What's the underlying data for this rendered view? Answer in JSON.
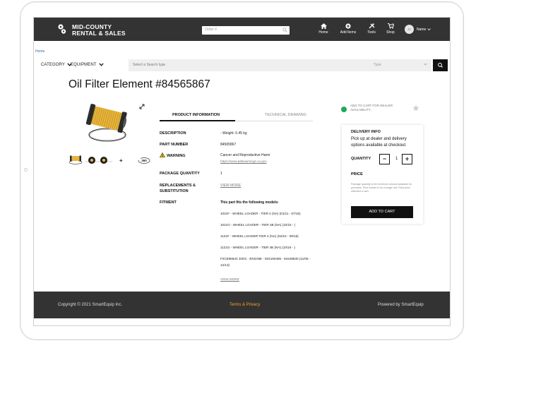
{
  "brand": {
    "line1": "MID-COUNTY",
    "line2": "RENTAL & SALES"
  },
  "search": {
    "placeholder": "Order #"
  },
  "nav": [
    {
      "label": "Home",
      "icon": "home-icon"
    },
    {
      "label": "Add Items",
      "icon": "add-circle-icon"
    },
    {
      "label": "Tools",
      "icon": "tools-icon"
    },
    {
      "label": "Shop",
      "icon": "cart-icon"
    }
  ],
  "user": {
    "initials": "JS",
    "name": "Name"
  },
  "breadcrumb": "Home",
  "filters": {
    "category": "CATEGORY",
    "equipment": "EQUIPMENT",
    "type_placeholder": "Select a Search type",
    "type_value": "Type"
  },
  "product": {
    "title": "Oil Filter Element #84565867",
    "tabs": {
      "info": "PRODUCT INFORMATION",
      "drawing": "TECHNICAL DRAWING"
    },
    "plus": "+",
    "spin_label": "360",
    "details": {
      "description_label": "DESCRIPTION",
      "description_value": "- Weight: 0.45 kg",
      "part_label": "PART NUMBER",
      "part_value": "84565867",
      "warning_label": "WARNING",
      "warning_value": "Cancer and Reproductive Harm",
      "warning_link": "https://www.p65warnings.ca.gov",
      "package_label": "PACKAGE QUANTITY",
      "package_value": "1",
      "replacements_label_1": "REPLACEMENTS &",
      "replacements_label_2": "SUBSTITUTION",
      "replacements_link": "VIEW MORE",
      "fitment_label": "FITMENT",
      "fitment_head": "This part fits the following models:",
      "fitment_models": [
        "1021F - WHEEL LOADER - TIER 4 (NA) (01/11 - 07/16)",
        "1021G - WHEEL LOADER - TIER 4B (NA) (10/16 - )",
        "1121F - WHEEL LOADER TIER 4 (NA) (04/10 - 09/16)",
        "1121G - WHEEL LOADER - TIER 4B (NA) (10/16 - )",
        "F2CE9684C E001 - ENGINE - 504160465 - 84448830 (11/06 -",
        "12/13)"
      ],
      "fitment_link": "VIEW MORE"
    }
  },
  "availability": {
    "text": "ADD TO CART FOR DEALER AVAILABILITY",
    "color": "#1ea85a"
  },
  "delivery": {
    "heading": "DELIVERY INFO",
    "text": "Pick up at dealer and delivery options available at checkout.",
    "qty_label": "QUANTITY",
    "qty_minus": "−",
    "qty_value": "1",
    "qty_plus": "+",
    "price_label": "PRICE",
    "note": "Package quantity is the minimum amount available for purchase. Price shown is for a single unit. Final price reflected in cart.",
    "add_to_cart": "ADD TO CART"
  },
  "footer": {
    "copyright": "Copyright © 2021 SmartEquip Inc.",
    "terms": "Terms & Privacy",
    "powered": "Powered by SmartEquip",
    "terms_color": "#f0a22e"
  }
}
